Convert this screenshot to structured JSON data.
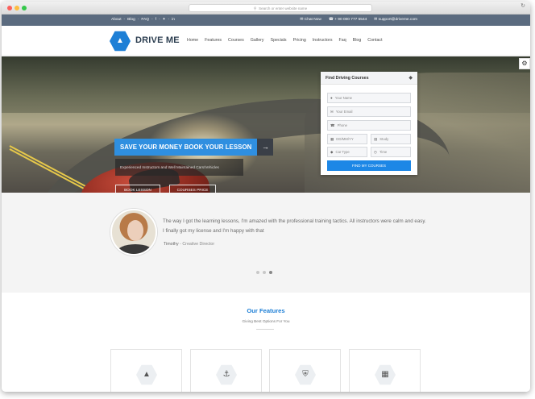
{
  "browser": {
    "url_placeholder": "Search or enter website name",
    "reload_icon": "reload-icon"
  },
  "topbar": {
    "links": [
      "About",
      "Blog",
      "FAQ"
    ],
    "social": [
      "f",
      "•",
      "in"
    ],
    "chat": "Chat Now",
    "phone": "+ 90 000 777 5544",
    "email": "support@driveme.com"
  },
  "nav": {
    "brand": "DRIVE ME",
    "menu": [
      "Home",
      "Features",
      "Courses",
      "Gallery",
      "Specials",
      "Pricing",
      "Instructors",
      "Faq",
      "Blog",
      "Contact"
    ]
  },
  "hero": {
    "cta_label": "SAVE YOUR MONEY BOOK YOUR LESSON",
    "cta_arrow": "→",
    "subtitle": "Experienced Instructors and Well Maintained Cars/Vehicles",
    "btn_book": "BOOK LESSON",
    "btn_price": "COURSES PRICE"
  },
  "booking": {
    "title": "Find Driving Courses",
    "name_placeholder": "Your Name",
    "email_placeholder": "Your Email",
    "phone_placeholder": "Phone",
    "date_placeholder": "DD/MM/YY",
    "study_placeholder": "Study",
    "cartype_placeholder": "Car Type",
    "time_placeholder": "Time",
    "submit": "FIND MY COURSES"
  },
  "testimonial": {
    "quote": "The way I got the learning lessons, I'm amazed with the professional training tactics. All instructors were calm and easy. I finally got my license and I'm happy with that",
    "author": "Timothy",
    "role": "- Creative Director"
  },
  "features": {
    "title": "Our Features",
    "subtitle": "Giving Best Options For You",
    "cards": [
      {
        "icon": "road-icon"
      },
      {
        "icon": "anchor-icon"
      },
      {
        "icon": "shield-icon"
      },
      {
        "icon": "calendar-icon"
      }
    ]
  },
  "colors": {
    "accent": "#1d87e6",
    "topbar": "#5b6b7f",
    "brand_text": "#2c3e50"
  }
}
